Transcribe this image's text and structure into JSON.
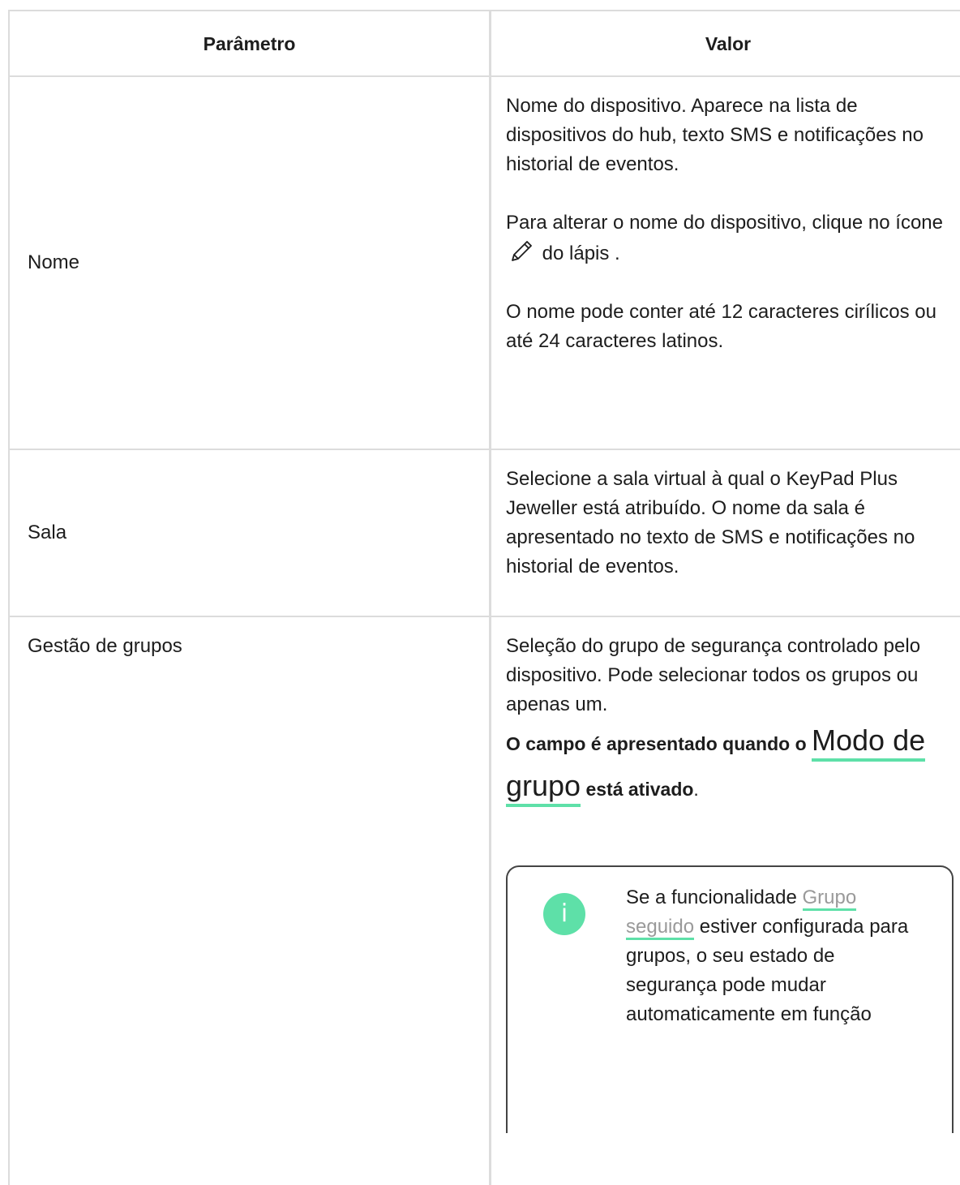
{
  "header": {
    "param": "Parâmetro",
    "value": "Valor"
  },
  "rows": {
    "nome": {
      "param": "Nome",
      "p1": "Nome do dispositivo. Aparece na lista de dispositivos do hub, texto SMS e notificações no historial de eventos.",
      "p2_before": "Para alterar o nome do dispositivo, clique no ícone ",
      "p2_after": " do lápis .",
      "icon": "pencil-icon",
      "p3": "O nome pode conter até 12 caracteres cirílicos ou até 24 caracteres latinos."
    },
    "sala": {
      "param": "Sala",
      "p1": "Selecione a sala virtual à qual o KeyPad Plus Jeweller está atribuído. O nome da sala é apresentado no texto de SMS e notificações no historial de eventos."
    },
    "grupos": {
      "param": "Gestão de grupos",
      "p1": "Seleção do grupo de segurança controlado pelo dispositivo. Pode selecionar todos os grupos ou apenas um.",
      "note_before": "O campo é apresentado quando o ",
      "note_link": "Modo de grupo",
      "note_after": " está ativado",
      "note_end": ".",
      "callout": {
        "icon": "info-icon",
        "icon_glyph": "i",
        "text_before": "Se a funcionalidade ",
        "link": "Grupo seguido",
        "text_after": " estiver configurada para grupos, o seu estado de segurança pode mudar automaticamente em função"
      }
    }
  },
  "colors": {
    "accent": "#5ee0a8",
    "border": "#dcdcdc",
    "link_grey": "#9a9a9a"
  }
}
